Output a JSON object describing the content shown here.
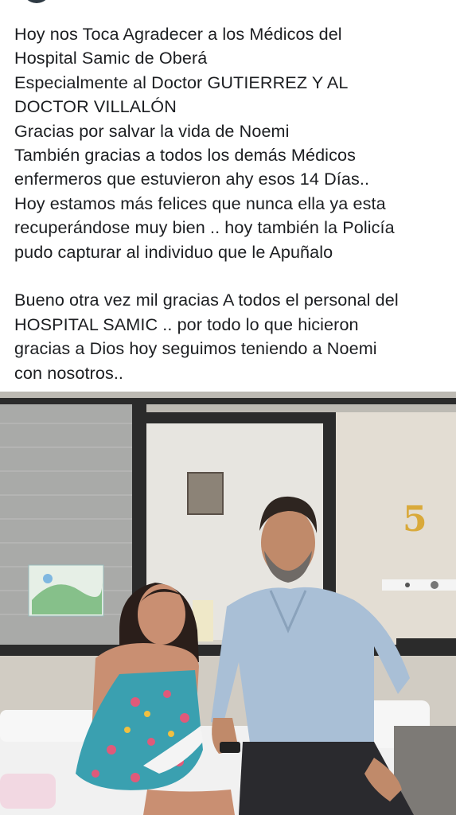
{
  "post": {
    "lines_block1": [
      "Hoy nos Toca Agradecer a los Médicos del",
      "Hospital Samic de Oberá",
      "Especialmente al Doctor GUTIERREZ Y AL",
      "DOCTOR VILLALÓN",
      "Gracias por salvar la vida de Noemi",
      "También gracias a todos los demás Médicos",
      "enfermeros que estuvieron ahy esos 14 Días..",
      "Hoy estamos más felices que nunca ella ya esta",
      "recuperándose muy bien .. hoy también la Policía",
      "pudo capturar al individuo que le Apuñalo"
    ],
    "lines_block2": [
      "Bueno otra vez mil gracias A todos el personal del",
      "HOSPITAL SAMIC .. por todo lo que hicieron",
      "gracias a Dios hoy seguimos teniendo a Noemi",
      "con nosotros.."
    ]
  },
  "photo": {
    "wall_number": "5",
    "colors": {
      "window_frame": "#2b2b2b",
      "wall": "#d8d4cc",
      "shirt": "#a9bfd6",
      "dress": "#3aa0b0",
      "bed": "#f2f2f2"
    }
  }
}
